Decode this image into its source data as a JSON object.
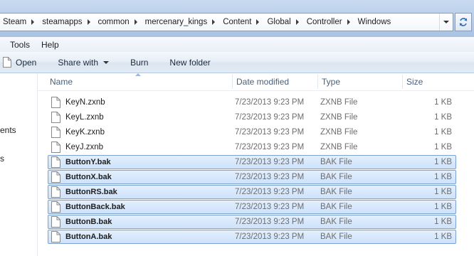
{
  "address_bar": {
    "crumbs": [
      "Steam",
      "steamapps",
      "common",
      "mercenary_kings",
      "Content",
      "Global",
      "Controller",
      "Windows"
    ]
  },
  "menu": {
    "items": [
      "Tools",
      "Help"
    ]
  },
  "toolbar": {
    "open": "Open",
    "share_with": "Share with",
    "burn": "Burn",
    "new_folder": "New folder"
  },
  "nav_pane": {
    "fragments": [
      "ents",
      "s"
    ]
  },
  "columns": {
    "name": "Name",
    "date": "Date modified",
    "type": "Type",
    "size": "Size"
  },
  "files": [
    {
      "name": "KeyN.zxnb",
      "date": "7/23/2013 9:23 PM",
      "type": "ZXNB File",
      "size": "1 KB",
      "selected": false
    },
    {
      "name": "KeyL.zxnb",
      "date": "7/23/2013 9:23 PM",
      "type": "ZXNB File",
      "size": "1 KB",
      "selected": false
    },
    {
      "name": "KeyK.zxnb",
      "date": "7/23/2013 9:23 PM",
      "type": "ZXNB File",
      "size": "1 KB",
      "selected": false
    },
    {
      "name": "KeyJ.zxnb",
      "date": "7/23/2013 9:23 PM",
      "type": "ZXNB File",
      "size": "1 KB",
      "selected": false
    },
    {
      "name": "ButtonY.bak",
      "date": "7/23/2013 9:23 PM",
      "type": "BAK File",
      "size": "1 KB",
      "selected": true
    },
    {
      "name": "ButtonX.bak",
      "date": "7/23/2013 9:23 PM",
      "type": "BAK File",
      "size": "1 KB",
      "selected": true
    },
    {
      "name": "ButtonRS.bak",
      "date": "7/23/2013 9:23 PM",
      "type": "BAK File",
      "size": "1 KB",
      "selected": true
    },
    {
      "name": "ButtonBack.bak",
      "date": "7/23/2013 9:23 PM",
      "type": "BAK File",
      "size": "1 KB",
      "selected": true
    },
    {
      "name": "ButtonB.bak",
      "date": "7/23/2013 9:23 PM",
      "type": "BAK File",
      "size": "1 KB",
      "selected": true
    },
    {
      "name": "ButtonA.bak",
      "date": "7/23/2013 9:23 PM",
      "type": "BAK File",
      "size": "1 KB",
      "selected": true
    }
  ],
  "icons": {
    "file": "generic-file-icon",
    "refresh": "refresh-icon",
    "open": "document-icon"
  },
  "colors": {
    "selection_fill": "#cde2fb",
    "selection_border": "#7da2ce",
    "header_text": "#4c607a"
  }
}
